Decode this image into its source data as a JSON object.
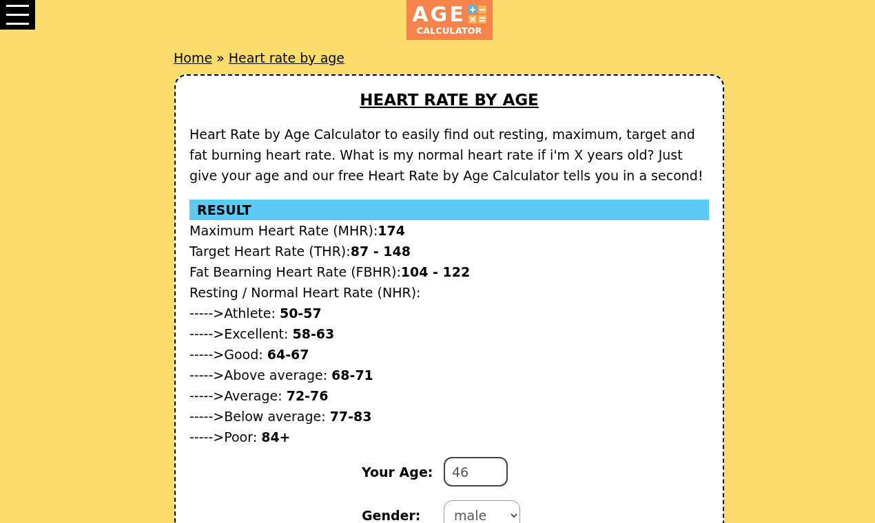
{
  "header": {
    "logo_top": "AGE",
    "logo_bottom": "CALCULATOR"
  },
  "breadcrumb": [
    {
      "label": "Home",
      "kind": "link"
    },
    {
      "label": "»",
      "kind": "separator"
    },
    {
      "label": "Heart rate by age",
      "kind": "link"
    }
  ],
  "card": {
    "title": "HEART RATE BY AGE",
    "intro": "Heart Rate by Age Calculator to easily find out resting, maximum, target and fat burning heart rate. What is my normal heart rate if i'm X years old? Just give your age and our free Heart Rate by Age Calculator tells you in a second!",
    "result_heading": "RESULT",
    "results": [
      {
        "label": "Maximum Heart Rate (MHR):",
        "value": "174"
      },
      {
        "label": "Target Heart Rate (THR):",
        "value": "87 - 148"
      },
      {
        "label": "Fat Bearning Heart Rate (FBHR):",
        "value": "104 - 122"
      },
      {
        "label": "Resting / Normal Heart Rate (NHR):"
      },
      {
        "label": "----->Athlete: ",
        "value": "50-57"
      },
      {
        "label": "----->Excellent: ",
        "value": "58-63"
      },
      {
        "label": "----->Good: ",
        "value": "64-67"
      },
      {
        "label": "----->Above average: ",
        "value": "68-71"
      },
      {
        "label": "----->Average: ",
        "value": "72-76"
      },
      {
        "label": "----->Below average: ",
        "value": "77-83"
      },
      {
        "label": "----->Poor: ",
        "value": "84+"
      }
    ],
    "form": [
      {
        "label": "Your Age:",
        "kind": "input",
        "value": "46"
      },
      {
        "label": "Gender:",
        "kind": "select",
        "value": "male"
      }
    ]
  }
}
